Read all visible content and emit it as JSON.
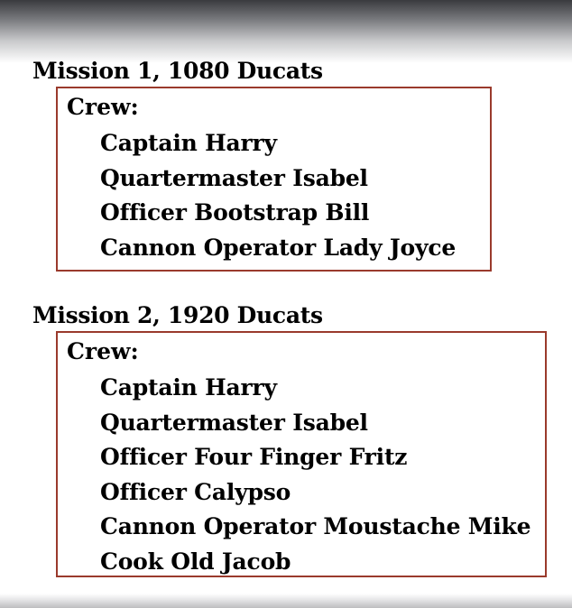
{
  "missions": [
    {
      "title": "Mission 1, 1080 Ducats",
      "crew_label": "Crew:",
      "crew": [
        "Captain Harry",
        "Quartermaster Isabel",
        "Officer Bootstrap Bill",
        "Cannon Operator Lady Joyce"
      ]
    },
    {
      "title": "Mission 2, 1920 Ducats",
      "crew_label": "Crew:",
      "crew": [
        "Captain Harry",
        "Quartermaster Isabel",
        "Officer Four Finger Fritz",
        "Officer Calypso",
        "Cannon Operator Moustache Mike",
        "Cook Old Jacob"
      ]
    }
  ],
  "colors": {
    "box_border": "#9a3a2c",
    "text": "#000000",
    "background": "#ffffff"
  }
}
